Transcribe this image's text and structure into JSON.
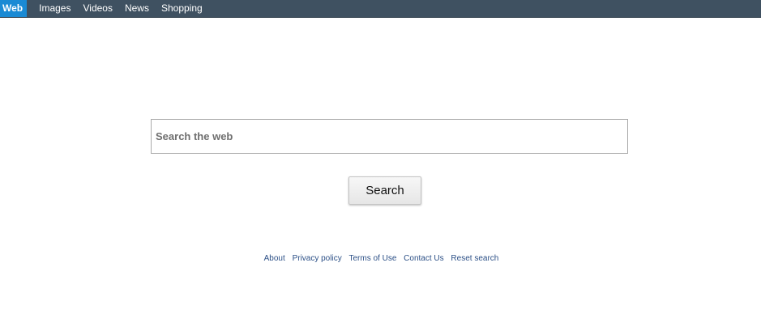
{
  "nav": {
    "tabs": [
      {
        "label": "Web",
        "active": true
      },
      {
        "label": "Images",
        "active": false
      },
      {
        "label": "Videos",
        "active": false
      },
      {
        "label": "News",
        "active": false
      },
      {
        "label": "Shopping",
        "active": false
      }
    ]
  },
  "search": {
    "placeholder": "Search the web",
    "value": "",
    "button_label": "Search"
  },
  "footer": {
    "links": [
      "About",
      "Privacy policy",
      "Terms of Use",
      "Contact Us",
      "Reset search"
    ]
  },
  "colors": {
    "topbar": "#3f5161",
    "active_tab": "#1a8ad4",
    "link": "#2b4f86"
  }
}
